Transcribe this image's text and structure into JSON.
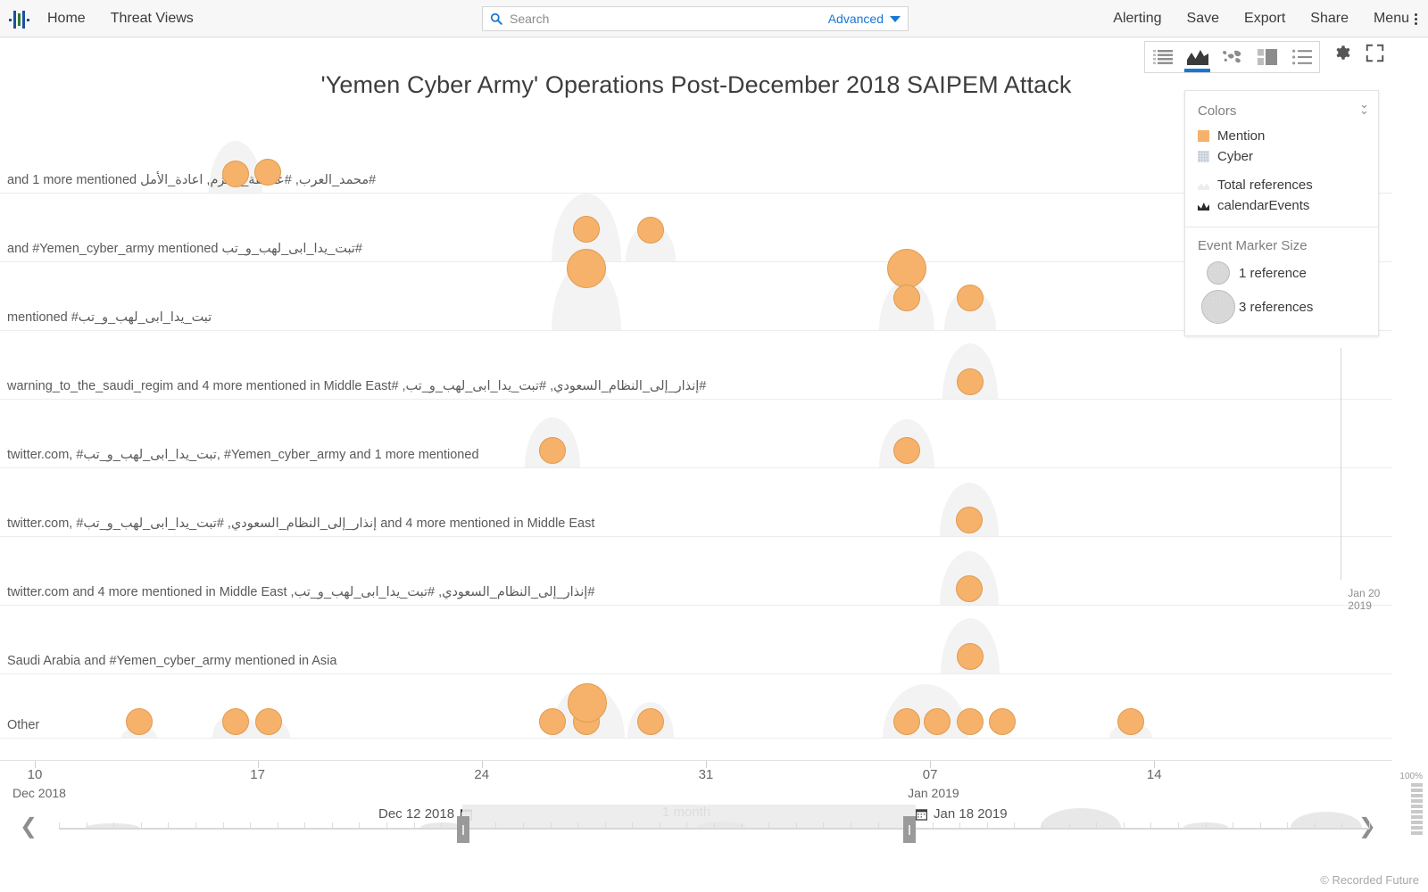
{
  "nav": {
    "logo_name": "recorded-future-logo",
    "links": [
      {
        "id": "home",
        "label": "Home"
      },
      {
        "id": "threat-views",
        "label": "Threat Views"
      }
    ],
    "search": {
      "placeholder": "Search",
      "value": "",
      "advanced_label": "Advanced"
    },
    "right_links": [
      {
        "id": "alerting",
        "label": "Alerting"
      },
      {
        "id": "save",
        "label": "Save"
      },
      {
        "id": "export",
        "label": "Export"
      },
      {
        "id": "share",
        "label": "Share"
      },
      {
        "id": "menu",
        "label": "Menu"
      }
    ]
  },
  "viewbar": {
    "buttons": [
      {
        "id": "list-view",
        "icon": "list-view-icon",
        "active": false
      },
      {
        "id": "timeline-view",
        "icon": "area-chart-icon",
        "active": true
      },
      {
        "id": "map-view",
        "icon": "world-map-icon",
        "active": false
      },
      {
        "id": "tile-view",
        "icon": "tile-view-icon",
        "active": false
      },
      {
        "id": "detail-list-view",
        "icon": "detail-list-icon",
        "active": false
      }
    ],
    "settings_icon": "gear-icon",
    "fullscreen_icon": "fullscreen-icon"
  },
  "title": "'Yemen Cyber Army' Operations Post-December 2018 SAIPEM Attack",
  "legend": {
    "colors_heading": "Colors",
    "collapse_icon": "chevron-double-down-icon",
    "color_items": [
      {
        "label": "Mention",
        "swatch": "mention",
        "color": "#F6B26B"
      },
      {
        "label": "Cyber",
        "swatch": "cyber",
        "color": "#DDE3EA"
      },
      {
        "label": "Total references",
        "swatch": "total",
        "color": "#EDEDED"
      },
      {
        "label": "calendarEvents",
        "swatch": "calendar",
        "color": "#2B2B2B"
      }
    ],
    "size_heading": "Event Marker Size",
    "size_items": [
      {
        "label": "1 reference",
        "diameter": 26
      },
      {
        "label": "3 references",
        "diameter": 38
      }
    ]
  },
  "chart_data": {
    "type": "scatter",
    "title": "'Yemen Cyber Army' Operations Post-December 2018 SAIPEM Attack",
    "xlabel": "",
    "ylabel": "",
    "grid": true,
    "legend_position": "top-right",
    "x_axis": {
      "type": "time",
      "range": [
        "Dec 8 2018",
        "Jan 18 2019"
      ],
      "ticks": [
        {
          "label": "10",
          "sub": "Dec 2018",
          "x_pct": 2.5
        },
        {
          "label": "17",
          "sub": "",
          "x_pct": 18.5
        },
        {
          "label": "24",
          "sub": "",
          "x_pct": 34.6
        },
        {
          "label": "31",
          "sub": "",
          "x_pct": 50.7
        },
        {
          "label": "07",
          "sub": "Jan 2019",
          "x_pct": 66.8
        },
        {
          "label": "14",
          "sub": "",
          "x_pct": 82.9
        }
      ]
    },
    "annotations": [
      {
        "label": "Jan 20 2019",
        "x_pct": 96.3
      }
    ],
    "rows": [
      {
        "label": "#محمد_العرب, #عاصفة_الحزم, اعادة_الأمل and 1 more mentioned",
        "points": [
          {
            "x_pct": 16.9,
            "refs": 1
          },
          {
            "x_pct": 19.2,
            "refs": 1
          }
        ]
      },
      {
        "label": "#تبت_يدا_ابى_لهب_و_تب and #Yemen_cyber_army mentioned",
        "points": [
          {
            "x_pct": 42.1,
            "refs": 1
          },
          {
            "x_pct": 46.7,
            "refs": 1
          },
          {
            "x_pct": 42.1,
            "refs": 3
          },
          {
            "x_pct": 65.1,
            "refs": 3
          }
        ]
      },
      {
        "label": "تبت_يدا_ابى_لهب_و_تب# mentioned",
        "points": [
          {
            "x_pct": 65.1,
            "refs": 1
          },
          {
            "x_pct": 69.7,
            "refs": 1
          }
        ]
      },
      {
        "label": "#إنذار_إلى_النظام_السعودي, #تبت_يدا_ابى_لهب_و_تب, #warning_to_the_saudi_regim and 4 more mentioned in Middle East",
        "points": [
          {
            "x_pct": 69.7,
            "refs": 1
          }
        ]
      },
      {
        "label": "twitter.com, #تبت_يدا_ابى_لهب_و_تب, #Yemen_cyber_army and 1 more mentioned",
        "points": [
          {
            "x_pct": 39.7,
            "refs": 1
          },
          {
            "x_pct": 65.1,
            "refs": 1
          }
        ]
      },
      {
        "label": "twitter.com, #إنذار_إلى_النظام_السعودي, #تبت_يدا_ابى_لهب_و_تب and 4 more mentioned in Middle East",
        "points": [
          {
            "x_pct": 69.6,
            "refs": 1
          }
        ]
      },
      {
        "label": "#إنذار_إلى_النظام_السعودي, #تبت_يدا_ابى_لهب_و_تب, twitter.com and 4 more mentioned in Middle East",
        "points": [
          {
            "x_pct": 69.6,
            "refs": 1
          }
        ]
      },
      {
        "label": "Saudi Arabia and #Yemen_cyber_army mentioned in Asia",
        "points": [
          {
            "x_pct": 69.7,
            "refs": 1
          }
        ]
      },
      {
        "label": "Other",
        "points": [
          {
            "x_pct": 10.0,
            "refs": 1
          },
          {
            "x_pct": 16.9,
            "refs": 1
          },
          {
            "x_pct": 19.3,
            "refs": 1
          },
          {
            "x_pct": 39.7,
            "refs": 1
          },
          {
            "x_pct": 42.1,
            "refs": 1
          },
          {
            "x_pct": 46.7,
            "refs": 1
          },
          {
            "x_pct": 42.2,
            "refs": 3
          },
          {
            "x_pct": 65.1,
            "refs": 1
          },
          {
            "x_pct": 67.3,
            "refs": 1
          },
          {
            "x_pct": 69.7,
            "refs": 1
          },
          {
            "x_pct": 72.0,
            "refs": 1
          },
          {
            "x_pct": 81.2,
            "refs": 1
          }
        ]
      }
    ]
  },
  "zoom_level": "100%",
  "slider": {
    "start_label": "Dec 12 2018",
    "end_label": "Jan 18 2019",
    "range_label": "1 month",
    "prev_icon": "chevron-left-icon",
    "next_icon": "chevron-right-icon",
    "calendar_icon": "calendar-icon"
  },
  "footer": {
    "copyright": "© Recorded Future"
  }
}
